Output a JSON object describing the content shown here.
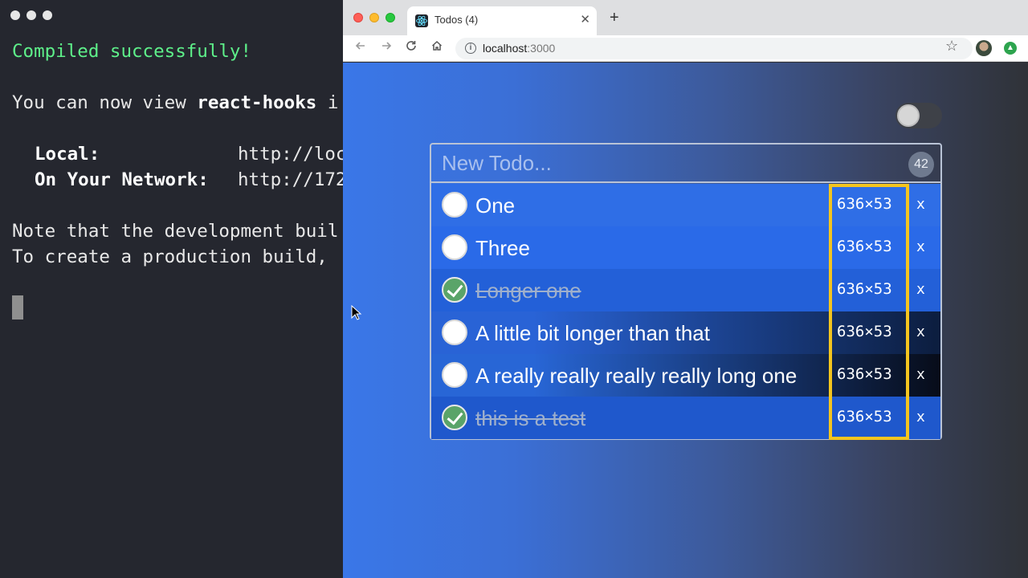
{
  "terminal": {
    "line1": "Compiled successfully!",
    "line2_prefix": "You can now view ",
    "line2_bold": "react-hooks",
    "line2_suffix": " i",
    "local_label": "Local:",
    "local_value": "http://loc",
    "network_label": "On Your Network:",
    "network_value": "http://172",
    "note_line1": "Note that the development buil",
    "note_line2": "To create a production build,"
  },
  "browser": {
    "tab_title": "Todos (4)",
    "tab_close": "✕",
    "new_tab": "+",
    "url_host": "localhost",
    "url_port": ":3000",
    "icons": {
      "back": "arrow-left-icon",
      "forward": "arrow-right-icon",
      "reload": "reload-icon",
      "home": "home-icon",
      "info": "info-icon",
      "star": "star-icon"
    }
  },
  "app": {
    "new_todo_placeholder": "New Todo...",
    "count": "42",
    "todos": [
      {
        "text": "One",
        "done": false,
        "size": "636×53",
        "delete": "x",
        "bg": "#2f6ee6"
      },
      {
        "text": "Three",
        "done": false,
        "size": "636×53",
        "delete": "x",
        "bg": "#2a6ae8"
      },
      {
        "text": "Longer one",
        "done": true,
        "size": "636×53",
        "delete": "x",
        "bg": "#2360d8"
      },
      {
        "text": "A little bit longer than that",
        "done": false,
        "size": "636×53",
        "delete": "x",
        "bg_left": "#2963d6",
        "bg_right": "#0c1d3e"
      },
      {
        "text": "A really really really really long one",
        "done": false,
        "size": "636×53",
        "delete": "x",
        "bg_left": "#2866d6",
        "bg_right": "#070c19"
      },
      {
        "text": "this is a test",
        "done": true,
        "size": "636×53",
        "delete": "x",
        "bg": "#1f58cc"
      }
    ],
    "highlight_color": "#f5c51e"
  }
}
